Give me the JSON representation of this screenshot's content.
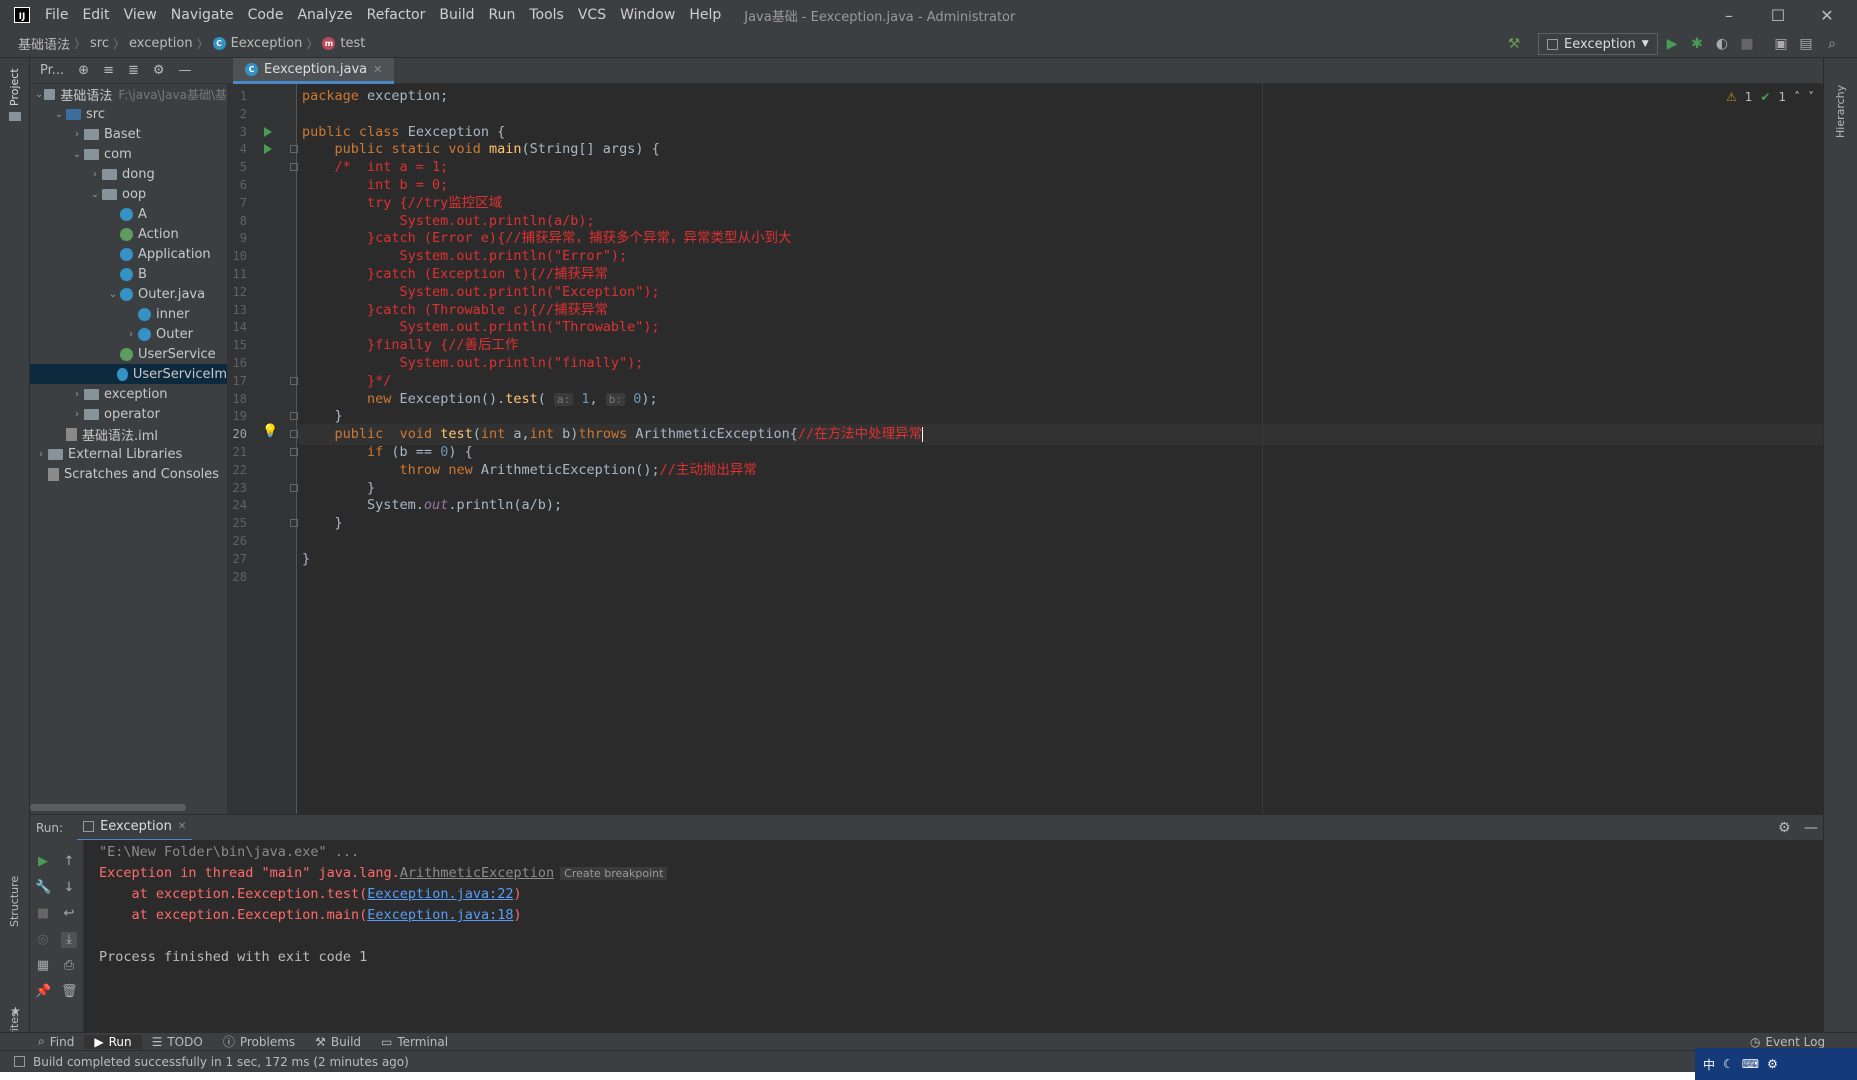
{
  "window": {
    "menus": [
      "File",
      "Edit",
      "View",
      "Navigate",
      "Code",
      "Analyze",
      "Refactor",
      "Build",
      "Run",
      "Tools",
      "VCS",
      "Window",
      "Help"
    ],
    "title": "Java基础 - Eexception.java - Administrator"
  },
  "breadcrumb": [
    "基础语法",
    "src",
    "exception",
    "Eexception",
    "test"
  ],
  "toolbar": {
    "run_config": "Eexception"
  },
  "project": {
    "title": "Pr...",
    "tree": [
      {
        "label": "基础语法",
        "hint": "F:\\java\\Java基础\\基",
        "depth": 0,
        "arrow": "v",
        "icon": "folder"
      },
      {
        "label": "src",
        "depth": 1,
        "arrow": "v",
        "icon": "folder-blue"
      },
      {
        "label": "Baset",
        "depth": 2,
        "arrow": ">",
        "icon": "folder"
      },
      {
        "label": "com",
        "depth": 2,
        "arrow": "v",
        "icon": "folder"
      },
      {
        "label": "dong",
        "depth": 3,
        "arrow": ">",
        "icon": "folder"
      },
      {
        "label": "oop",
        "depth": 3,
        "arrow": "v",
        "icon": "folder"
      },
      {
        "label": "A",
        "depth": 4,
        "arrow": "",
        "icon": "class"
      },
      {
        "label": "Action",
        "depth": 4,
        "arrow": "",
        "icon": "iface"
      },
      {
        "label": "Application",
        "depth": 4,
        "arrow": "",
        "icon": "class"
      },
      {
        "label": "B",
        "depth": 4,
        "arrow": "",
        "icon": "class"
      },
      {
        "label": "Outer.java",
        "depth": 4,
        "arrow": "v",
        "icon": "class"
      },
      {
        "label": "inner",
        "depth": 5,
        "arrow": "",
        "icon": "class"
      },
      {
        "label": "Outer",
        "depth": 5,
        "arrow": ">",
        "icon": "class"
      },
      {
        "label": "UserService",
        "depth": 4,
        "arrow": "",
        "icon": "iface"
      },
      {
        "label": "UserServiceIm",
        "depth": 4,
        "arrow": "",
        "icon": "class",
        "selected": true
      },
      {
        "label": "exception",
        "depth": 2,
        "arrow": ">",
        "icon": "folder"
      },
      {
        "label": "operator",
        "depth": 2,
        "arrow": ">",
        "icon": "folder"
      },
      {
        "label": "基础语法.iml",
        "depth": 1,
        "arrow": "",
        "icon": "file"
      },
      {
        "label": "External Libraries",
        "depth": 0,
        "arrow": ">",
        "icon": "lib"
      },
      {
        "label": "Scratches and Consoles",
        "depth": 0,
        "arrow": "",
        "icon": "scratch"
      }
    ]
  },
  "side_tabs": {
    "project": "Project",
    "structure": "Structure",
    "favorites": "Favorites",
    "hierarchy": "Hierarchy"
  },
  "editor": {
    "tab": "Eexception.java",
    "current_line": 20,
    "inspection": {
      "warnings": "1",
      "ok": "1"
    },
    "lines": [
      "package exception;",
      "",
      "public class Eexception {",
      "    public static void main(String[] args) {",
      "    /*  int a = 1;",
      "        int b = 0;",
      "        try {//try监控区域",
      "            System.out.println(a/b);",
      "        }catch (Error e){//捕获异常，捕获多个异常，异常类型从小到大",
      "            System.out.println(\"Error\");",
      "        }catch (Exception t){//捕获异常",
      "            System.out.println(\"Exception\");",
      "        }catch (Throwable c){//捕获异常",
      "            System.out.println(\"Throwable\");",
      "        }finally {//善后工作",
      "            System.out.println(\"finally\");",
      "        }*/",
      "        new Eexception().test( a: 1, b: 0);",
      "    }",
      "    public  void test(int a,int b)throws ArithmeticException{//在方法中处理异常",
      "        if (b == 0) {",
      "            throw new ArithmeticException();//主动抛出异常",
      "        }",
      "        System.out.println(a/b);",
      "    }",
      "",
      "}",
      ""
    ]
  },
  "run": {
    "label": "Run:",
    "tab": "Eexception",
    "console": {
      "cmd": "\"E:\\New Folder\\bin\\java.exe\" ...",
      "err_prefix": "Exception in thread \"main\" java.lang.",
      "err_class": "ArithmeticException",
      "create_bp": "Create breakpoint",
      "at1_prefix": "    at exception.Eexception.test(",
      "at1_link": "Eexception.java:22",
      "at2_prefix": "    at exception.Eexception.main(",
      "at2_link": "Eexception.java:18",
      "close_paren": ")",
      "finished": "Process finished with exit code 1"
    }
  },
  "bottom_tabs": [
    "Find",
    "Run",
    "TODO",
    "Problems",
    "Build",
    "Terminal"
  ],
  "event_log": "Event Log",
  "status": "Build completed successfully in 1 sec, 172 ms (2 minutes ago)",
  "tray": {
    "ime": "中"
  }
}
